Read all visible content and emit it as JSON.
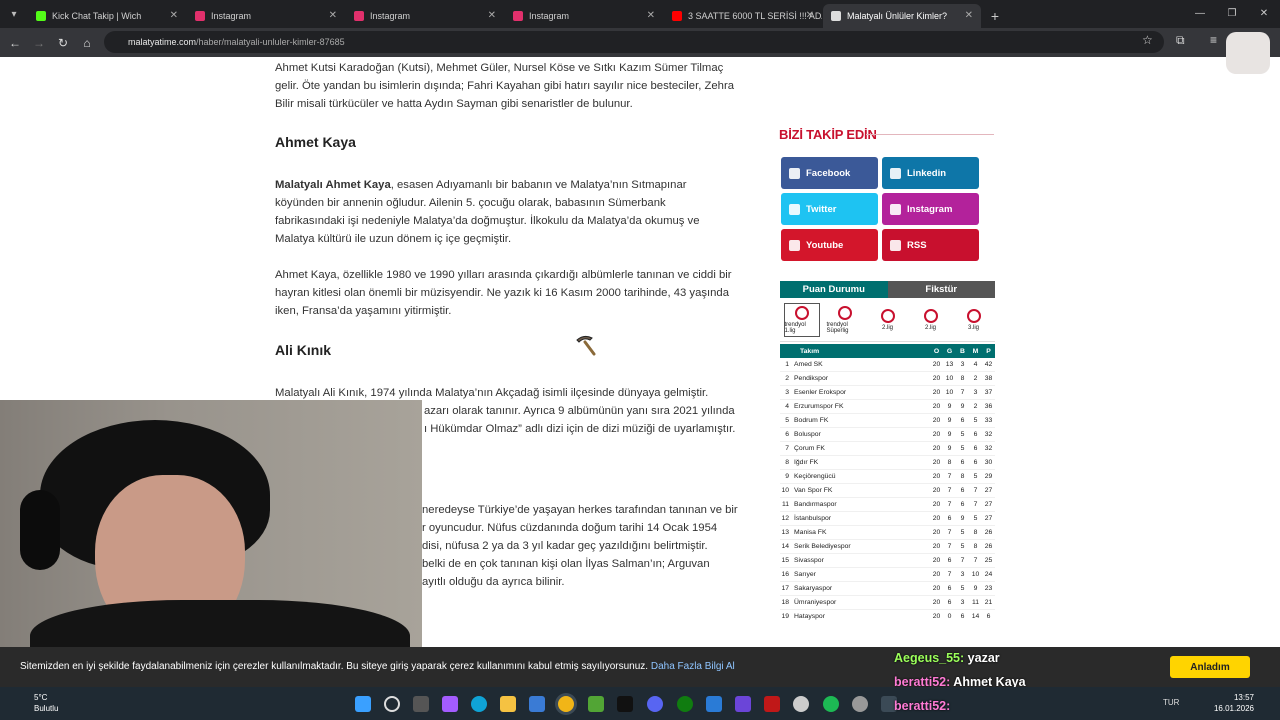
{
  "browser": {
    "tabs": [
      {
        "label": "Kick Chat Takip | Wich",
        "icon_color": "#53fc18"
      },
      {
        "label": "Instagram",
        "icon_color": "#e1306c"
      },
      {
        "label": "Instagram",
        "icon_color": "#e1306c"
      },
      {
        "label": "Instagram",
        "icon_color": "#e1306c"
      },
      {
        "label": "3 SAATTE 6000 TL SERİSİ !!! ADA",
        "icon_color": "#ff0000"
      },
      {
        "label": "Malatyalı Ünlüler Kimler?",
        "icon_color": "#dddddd"
      }
    ],
    "new_tab": "+",
    "url_host": "malatyatime.com",
    "url_path": "/haber/malatyali-unluler-kimler-87685"
  },
  "article": {
    "intro_line1": "Ahmet Kutsi Karadoğan (Kutsi), Mehmet Güler, Nursel Köse ve Sıtkı Kazım Sümer Tilmaç",
    "intro_line2": "gelir. Öte yandan bu isimlerin dışında; Fahri Kayahan gibi hatırı sayılır nice besteciler, Zehra",
    "intro_line3": "Bilir misali türkücüler ve hatta Aydın Sayman gibi senaristler de bulunur.",
    "h_ahmet": "Ahmet Kaya",
    "ahmet_bold": "Malatyalı Ahmet Kaya",
    "ahmet_p1_l1": ", esasen Adıyamanlı bir babanın ve Malatya’nın Sıtmapınar",
    "ahmet_p1_l2": "köyünden bir annenin oğludur. Ailenin 5. çocuğu olarak, babasının Sümerbank",
    "ahmet_p1_l3": "fabrikasındaki işi nedeniyle Malatya’da doğmuştur. İlkokulu da Malatya’da okumuş ve",
    "ahmet_p1_l4": "Malatya kültürü ile uzun dönem iç içe geçmiştir.",
    "ahmet_p2_l1": "Ahmet Kaya, özellikle 1980 ve 1990 yılları arasında çıkardığı albümlerle tanınan ve ciddi bir",
    "ahmet_p2_l2": "hayran kitlesi olan önemli bir müzisyendir. Ne yazık ki 16 Kasım 2000 tarihinde, 43 yaşında",
    "ahmet_p2_l3": "iken, Fransa’da yaşamını yitirmiştir.",
    "h_ali": "Ali Kınık",
    "ali_l1": "Malatyalı Ali Kınık, 1974 yılında Malatya’nın Akçadağ isimli ilçesinde dünyaya gelmiştir.",
    "ali_l2": "azarı olarak tanınır. Ayrıca 9 albümünün yanı sıra 2021 yılında",
    "ali_l3": "ı Hükümdar Olmaz” adlı dizi için de dizi müziği de uyarlamıştır.",
    "next_l1": "neredeyse Türkiye’de yaşayan herkes tarafından tanınan ve bir",
    "next_l2": "r oyuncudur. Nüfus cüzdanında doğum tarihi 14 Ocak 1954",
    "next_l3": "disi, nüfusa 2 ya da 3 yıl kadar geç yazıldığını belirtmiştir.",
    "next_l4": "belki de en çok tanınan kişi olan İlyas Salman’ın; Arguvan",
    "next_l5": "ayıtlı olduğu da ayrıca bilinir."
  },
  "sidebar": {
    "follow_title": "BİZİ TAKİP EDİN",
    "social": [
      {
        "label": "Facebook",
        "color": "#3b5998"
      },
      {
        "label": "Linkedin",
        "color": "#0e76a8"
      },
      {
        "label": "Twitter",
        "color": "#1da1f2"
      },
      {
        "label": "Instagram",
        "color": "#b3229b"
      },
      {
        "label": "Youtube",
        "color": "#d3162b"
      },
      {
        "label": "RSS",
        "color": "#c8102e"
      }
    ]
  },
  "standings": {
    "tab_active": "Puan Durumu",
    "tab_other": "Fikstür",
    "leagues": [
      "trendyol 1.lig",
      "trendyol Süperlig",
      "2.lig",
      "2.lig",
      "3.lig"
    ],
    "header": {
      "team": "Takım",
      "o": "O",
      "g": "G",
      "b": "B",
      "m": "M",
      "p": "P"
    },
    "rows": [
      [
        "1",
        "Amed SK",
        "20",
        "13",
        "3",
        "4",
        "42"
      ],
      [
        "2",
        "Pendikspor",
        "20",
        "10",
        "8",
        "2",
        "38"
      ],
      [
        "3",
        "Esenler Erokspor",
        "20",
        "10",
        "7",
        "3",
        "37"
      ],
      [
        "4",
        "Erzurumspor FK",
        "20",
        "9",
        "9",
        "2",
        "36"
      ],
      [
        "5",
        "Bodrum FK",
        "20",
        "9",
        "6",
        "5",
        "33"
      ],
      [
        "6",
        "Boluspor",
        "20",
        "9",
        "5",
        "6",
        "32"
      ],
      [
        "7",
        "Çorum FK",
        "20",
        "9",
        "5",
        "6",
        "32"
      ],
      [
        "8",
        "Iğdır FK",
        "20",
        "8",
        "6",
        "6",
        "30"
      ],
      [
        "9",
        "Keçiörengücü",
        "20",
        "7",
        "8",
        "5",
        "29"
      ],
      [
        "10",
        "Van Spor FK",
        "20",
        "7",
        "6",
        "7",
        "27"
      ],
      [
        "11",
        "Bandırmaspor",
        "20",
        "7",
        "6",
        "7",
        "27"
      ],
      [
        "12",
        "İstanbulspor",
        "20",
        "6",
        "9",
        "5",
        "27"
      ],
      [
        "13",
        "Manisa FK",
        "20",
        "7",
        "5",
        "8",
        "26"
      ],
      [
        "14",
        "Serik Belediyespor",
        "20",
        "7",
        "5",
        "8",
        "26"
      ],
      [
        "15",
        "Sivasspor",
        "20",
        "6",
        "7",
        "7",
        "25"
      ],
      [
        "16",
        "Sarıyer",
        "20",
        "7",
        "3",
        "10",
        "24"
      ],
      [
        "17",
        "Sakaryaspor",
        "20",
        "6",
        "5",
        "9",
        "23"
      ],
      [
        "18",
        "Ümraniyespor",
        "20",
        "6",
        "3",
        "11",
        "21"
      ],
      [
        "19",
        "Hatayspor",
        "20",
        "0",
        "6",
        "14",
        "6"
      ]
    ]
  },
  "cookie": {
    "text": "Sitemizden en iyi şekilde faydalanabilmeniz için çerezler kullanılmaktadır. Bu siteye giriş yaparak çerez kullanımını kabul etmiş sayılıyorsunuz.",
    "link": "Daha Fazla Bilgi Al",
    "button": "Anladım"
  },
  "chat": [
    {
      "user": "Aegeus_55:",
      "msg": "yazar"
    },
    {
      "user": "beratti52:",
      "msg": "Ahmet Kaya"
    },
    {
      "user": "beratti52:",
      "msg": ""
    }
  ],
  "taskbar": {
    "temp": "5°C",
    "weather": "Bulutlu",
    "lang": "TUR",
    "time": "13:57",
    "date": "16.01.2026"
  }
}
